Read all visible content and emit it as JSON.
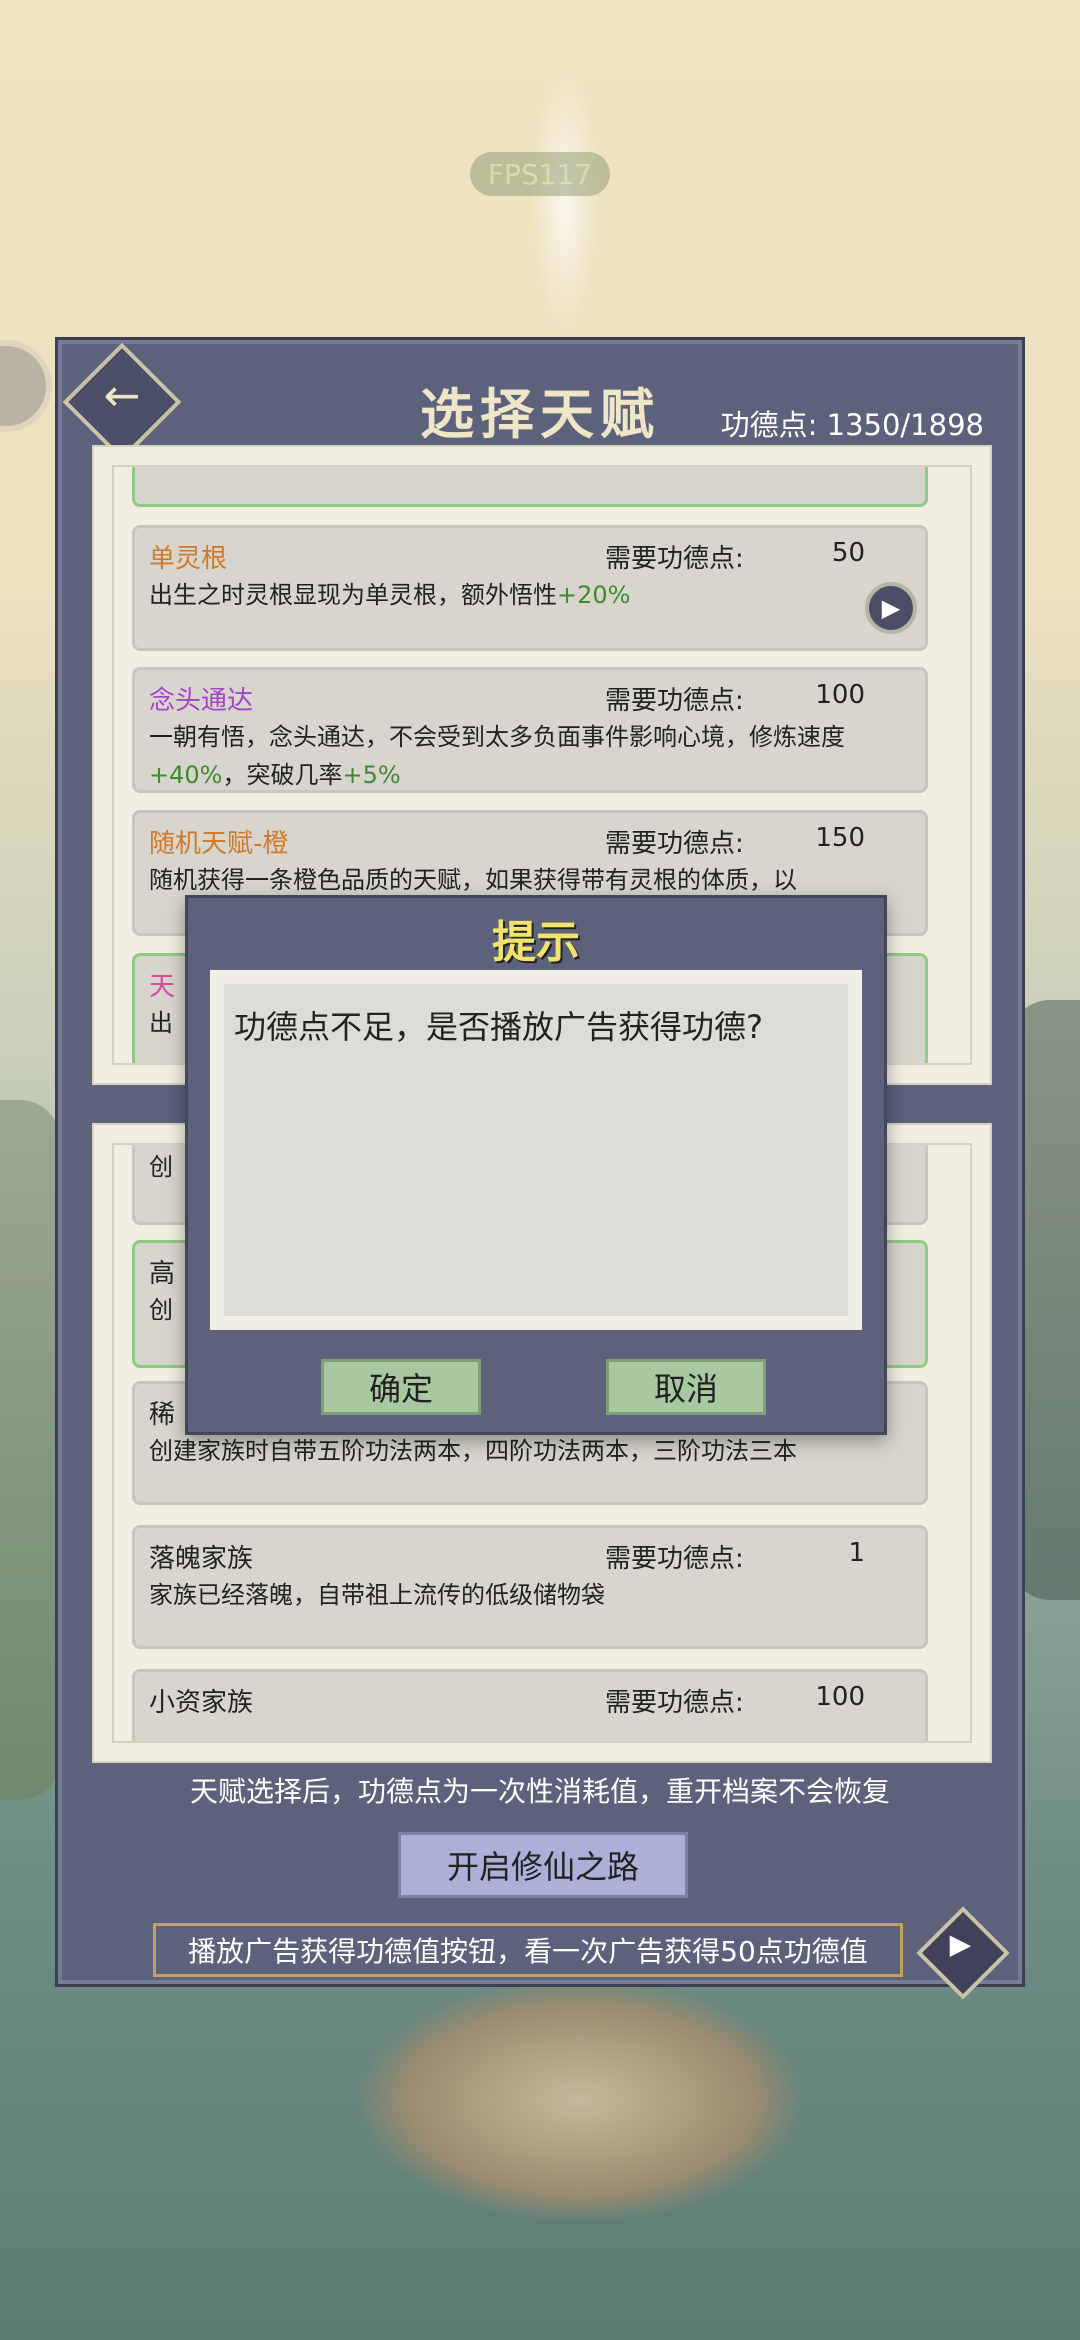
{
  "status": {
    "fps": "FPS117"
  },
  "header": {
    "title": "选择天赋",
    "merit_points": "功德点: 1350/1898"
  },
  "talent_list": [
    {
      "name": "",
      "cost_label": "",
      "cost": "",
      "desc": ""
    },
    {
      "name": "单灵根",
      "cost_label": "需要功德点:",
      "cost": "50",
      "desc_main": "出生之时灵根显现为单灵根，额外悟性",
      "desc_plus": "+20%"
    },
    {
      "name": "念头通达",
      "cost_label": "需要功德点:",
      "cost": "100",
      "desc_main": "一朝有悟，念头通达，不会受到太多负面事件影响心境，修炼速度",
      "desc_plus": "+40%",
      "desc_mid": "，突破几率",
      "desc_plus2": "+5%"
    },
    {
      "name": "随机天赋-橙",
      "cost_label": "需要功德点:",
      "cost": "150",
      "desc_main": "随机获得一条橙色品质的天赋，如果获得带有灵根的体质，以"
    },
    {
      "name": "天",
      "desc_main": "出"
    }
  ],
  "family_list": [
    {
      "name": "",
      "desc_main": "创"
    },
    {
      "name": "高",
      "desc_main": "创"
    },
    {
      "name": "稀",
      "desc_main": "创建家族时自带五阶功法两本，四阶功法两本，三阶功法三本"
    },
    {
      "name": "落魄家族",
      "cost_label": "需要功德点:",
      "cost": "1",
      "desc_main": "家族已经落魄，自带祖上流传的低级储物袋"
    },
    {
      "name": "小资家族",
      "cost_label": "需要功德点:",
      "cost": "100"
    }
  ],
  "footer": {
    "notice": "天赋选择后，功德点为一次性消耗值，重开档案不会恢复",
    "start_button": "开启修仙之路",
    "ad_text": "播放广告获得功德值按钮，看一次广告获得50点功德值"
  },
  "dialog": {
    "title": "提示",
    "message": "功德点不足，是否播放广告获得功德?",
    "confirm": "确定",
    "cancel": "取消"
  },
  "colors": {
    "panel": "#5d627c",
    "orange_tier": "#d07a2a",
    "purple_tier": "#a445c8",
    "bonus_green": "#3f8a33",
    "dialog_title": "#f1e46a"
  }
}
